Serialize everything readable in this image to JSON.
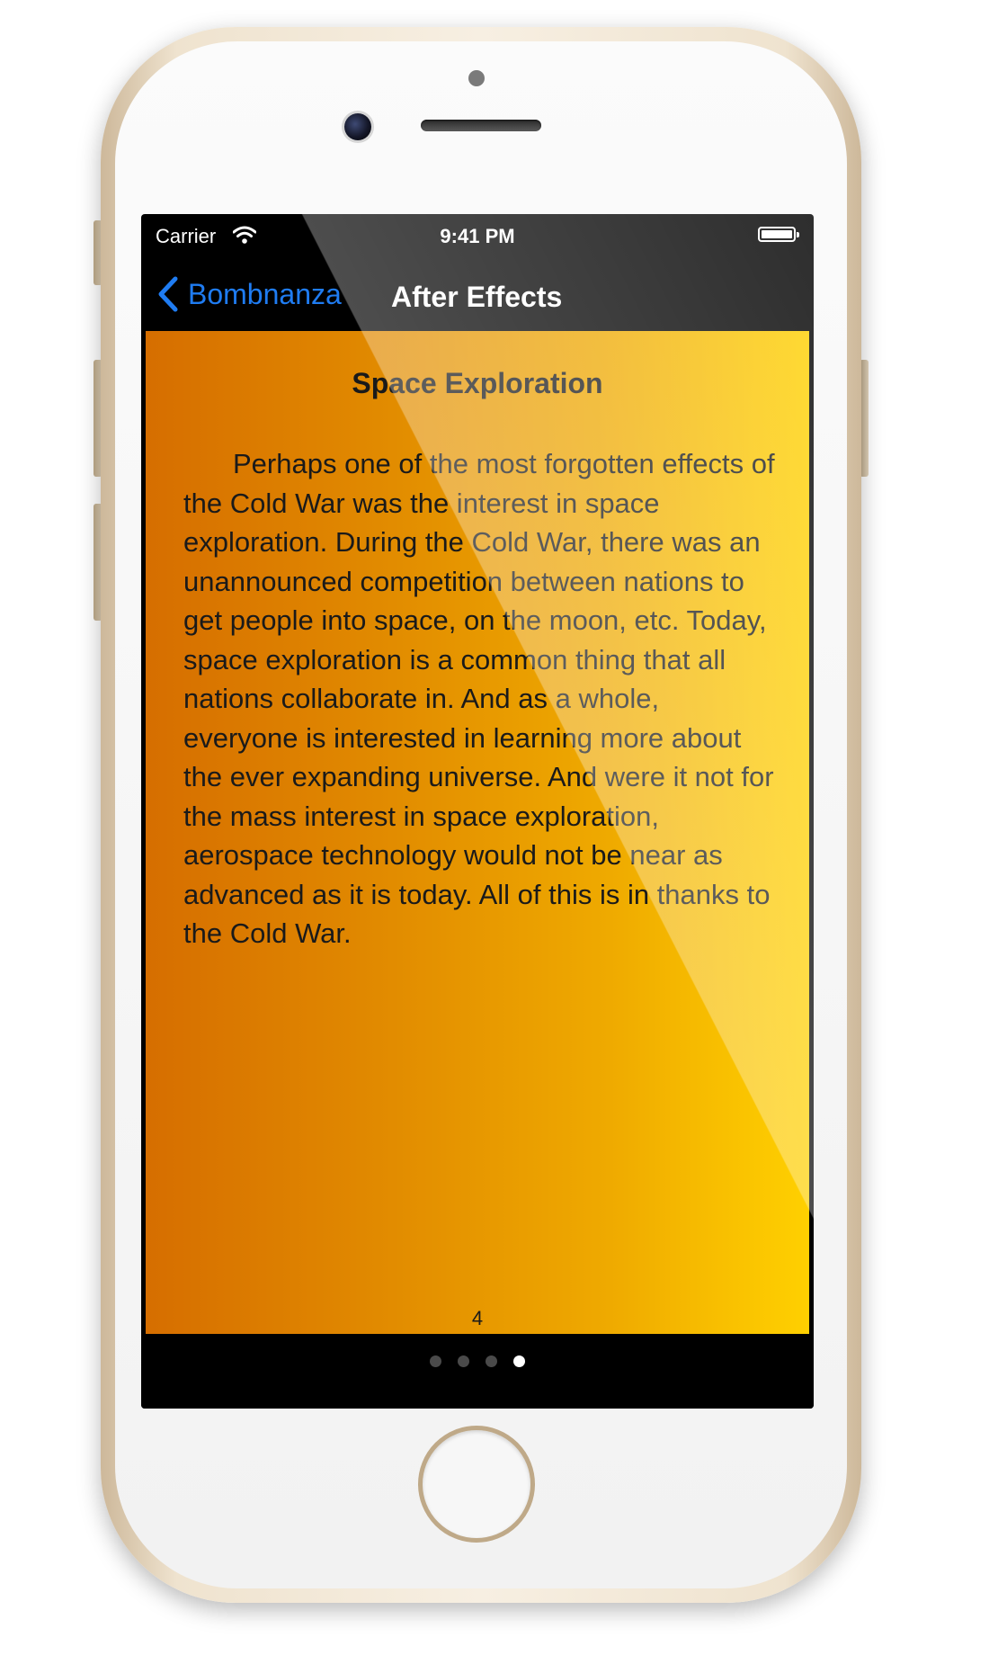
{
  "status_bar": {
    "carrier": "Carrier",
    "time": "9:41 PM",
    "icons": [
      "wifi-icon",
      "battery-icon"
    ]
  },
  "nav_bar": {
    "back_label": "Bombnanza",
    "title": "After Effects",
    "back_icon": "chevron-left-icon"
  },
  "content": {
    "heading": "Space Exploration",
    "body": "Perhaps one of the most forgotten effects of the Cold War was the interest in space exploration. During the Cold War, there was an unannounced competition between nations to get people into space, on the moon, etc. Today, space exploration is a common thing that all nations collaborate in. And as a whole, everyone is interested in learning more about the ever expanding universe. And were it not for the mass interest in space exploration, aerospace technology would not be near as advanced as it is today. All of this is in thanks to the Cold War.",
    "page_number": "4"
  },
  "page_control": {
    "total_pages": 4,
    "current_page": 4
  },
  "colors": {
    "accent": "#1f7cf2",
    "gradient_start": "#d66e00",
    "gradient_end": "#ffd000"
  }
}
